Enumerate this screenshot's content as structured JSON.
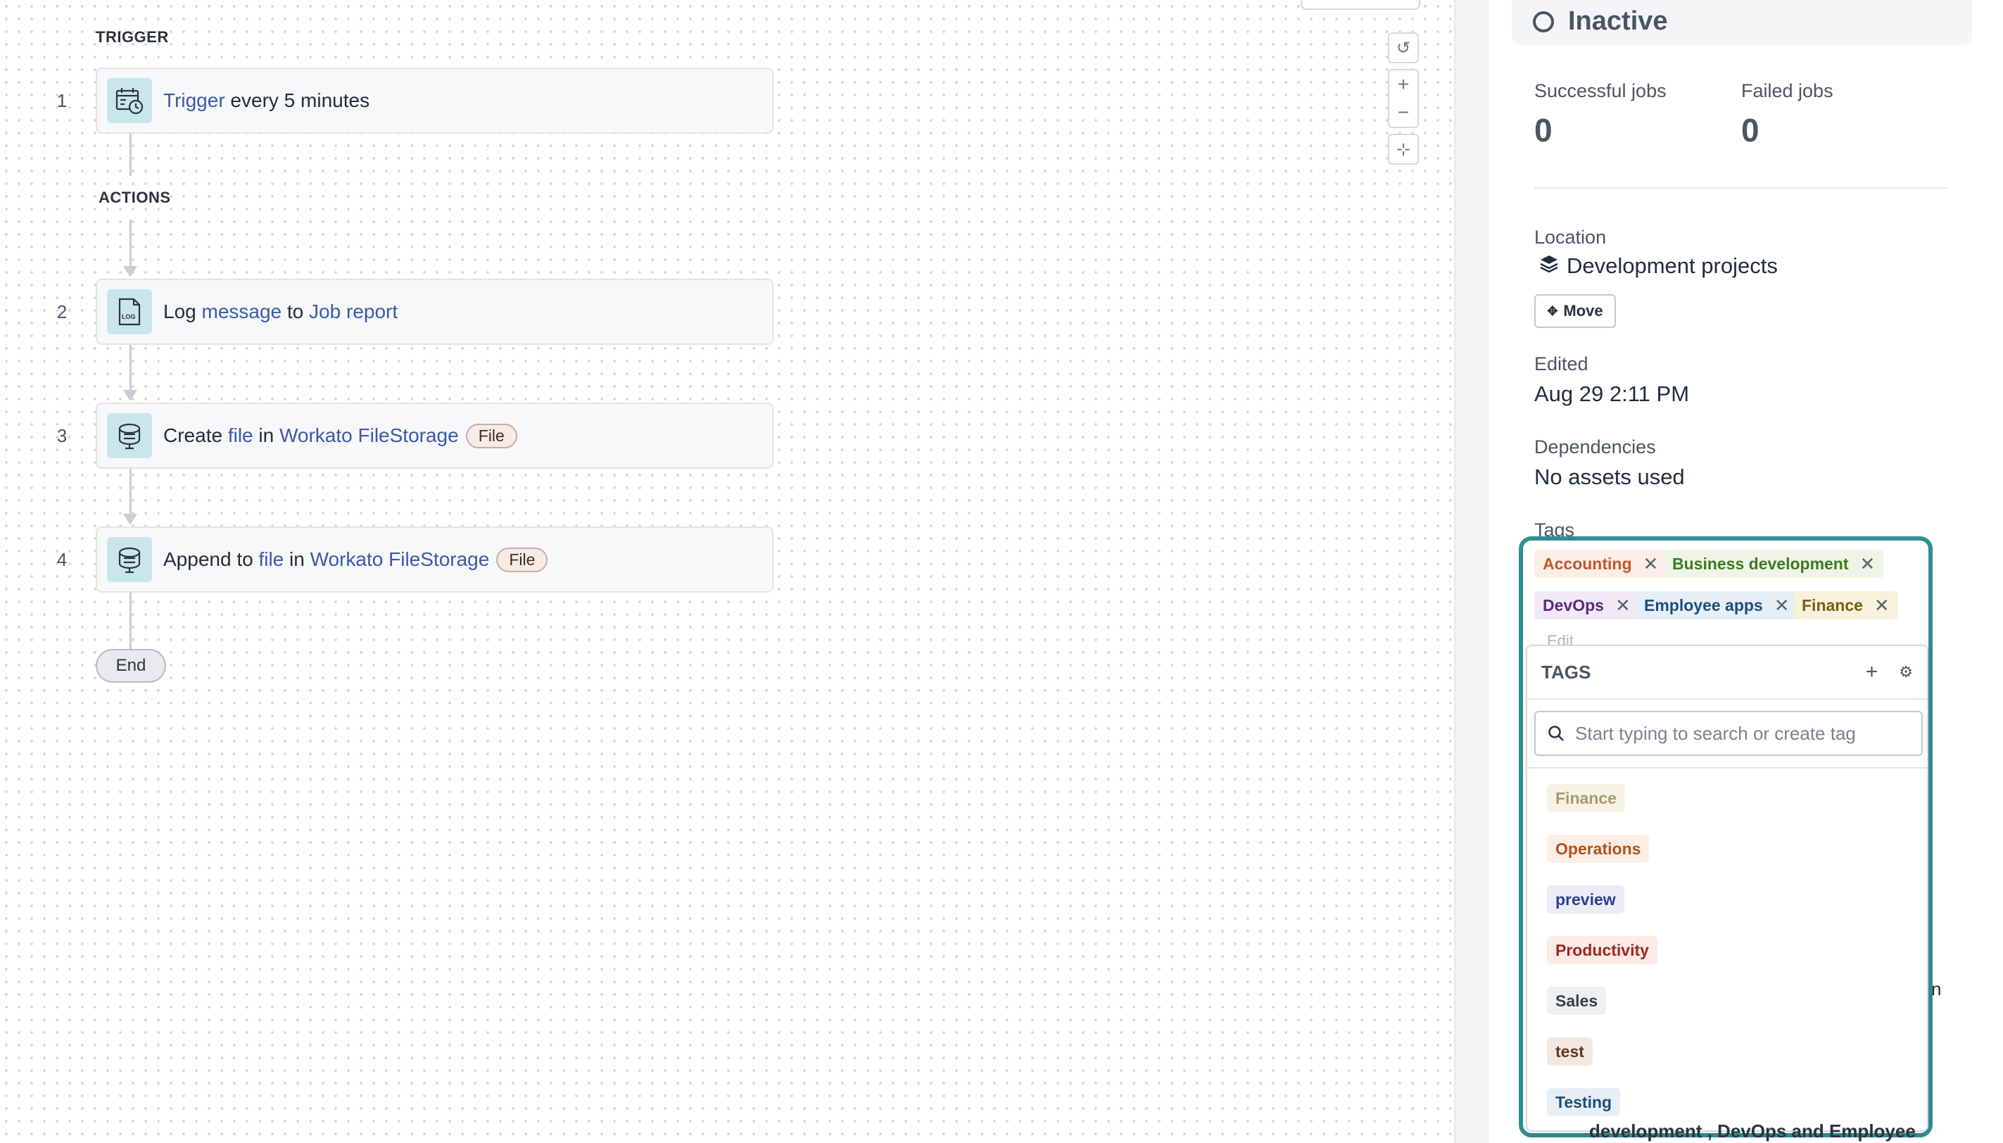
{
  "flow": {
    "trigger_label": "TRIGGER",
    "actions_label": "ACTIONS",
    "steps": [
      {
        "num": "1",
        "parts": [
          "Trigger",
          " every 5 minutes"
        ],
        "icon": "calendar-clock-icon"
      },
      {
        "num": "2",
        "parts": [
          "Log ",
          "message",
          " to ",
          "Job report"
        ],
        "icon": "log-icon"
      },
      {
        "num": "3",
        "parts": [
          "Create ",
          "file",
          " in ",
          "Workato FileStorage"
        ],
        "pill": "File",
        "icon": "file-storage-icon"
      },
      {
        "num": "4",
        "parts": [
          "Append to ",
          "file",
          " in ",
          "Workato FileStorage"
        ],
        "pill": "File",
        "icon": "file-storage-icon"
      }
    ],
    "end_label": "End"
  },
  "zoom_controls": {
    "reset": "↺",
    "zoom_in": "+",
    "zoom_out": "−",
    "fit": "⊹"
  },
  "panel": {
    "status": "Inactive",
    "successful_jobs_label": "Successful jobs",
    "successful_jobs": "0",
    "failed_jobs_label": "Failed jobs",
    "failed_jobs": "0",
    "location_label": "Location",
    "location_value": "Development projects",
    "move_label": "Move",
    "edited_label": "Edited",
    "edited_value": "Aug 29 2:11 PM",
    "dependencies_label": "Dependencies",
    "dependencies_value": "No assets used",
    "tags_label": "Tags",
    "edit_label": "Edit",
    "underlay_text_1": "n",
    "underlay_text_2": "development , DevOps  and  Employee"
  },
  "selected_tags": [
    {
      "label": "Accounting",
      "color": "#c4572a",
      "bg": "#fbeee6"
    },
    {
      "label": "Business development",
      "color": "#3e7a1f",
      "bg": "#eef5e6"
    },
    {
      "label": "DevOps",
      "color": "#5a2a7a",
      "bg": "#f1e9f6"
    },
    {
      "label": "Employee apps",
      "color": "#1f4e7a",
      "bg": "#e7eef6"
    },
    {
      "label": "Finance",
      "color": "#7a5c14",
      "bg": "#f8f1dc"
    }
  ],
  "dropdown": {
    "title": "TAGS",
    "add_icon": "+",
    "settings_icon": "⚙",
    "search_placeholder": "Start typing to search or create tag",
    "options": [
      {
        "label": "Finance",
        "color": "#a89a6e",
        "bg": "#f6f2e6"
      },
      {
        "label": "Operations",
        "color": "#b0531d",
        "bg": "#fbeee6"
      },
      {
        "label": "preview",
        "color": "#2e3d8f",
        "bg": "#eaedf8"
      },
      {
        "label": "Productivity",
        "color": "#a1281f",
        "bg": "#fbeae8"
      },
      {
        "label": "Sales",
        "color": "#3a3f47",
        "bg": "#eef0f2"
      },
      {
        "label": "test",
        "color": "#5c3a26",
        "bg": "#f3e8df"
      },
      {
        "label": "Testing",
        "color": "#1f4e7a",
        "bg": "#e7eef6"
      }
    ]
  }
}
